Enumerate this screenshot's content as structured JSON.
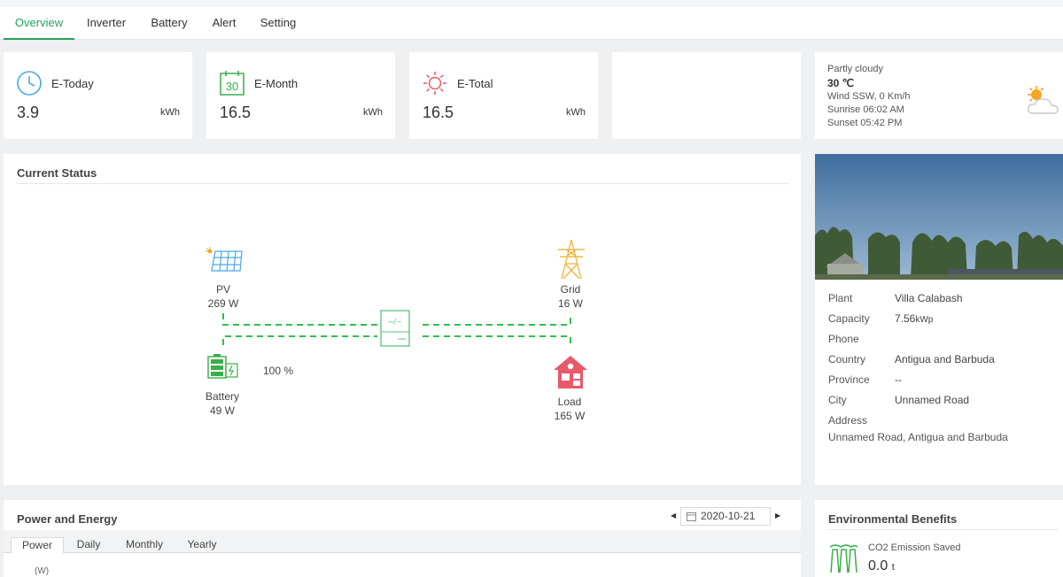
{
  "tabs": [
    {
      "label": "Overview",
      "active": true
    },
    {
      "label": "Inverter",
      "active": false
    },
    {
      "label": "Battery",
      "active": false
    },
    {
      "label": "Alert",
      "active": false
    },
    {
      "label": "Setting",
      "active": false
    }
  ],
  "stats": {
    "today": {
      "label": "E-Today",
      "value": "3.9",
      "unit": "kWh",
      "icon": "clock-icon"
    },
    "month": {
      "label": "E-Month",
      "value": "16.5",
      "unit": "kWh",
      "icon": "calendar-icon",
      "icon_text": "30"
    },
    "total": {
      "label": "E-Total",
      "value": "16.5",
      "unit": "kWh",
      "icon": "sun-icon"
    }
  },
  "weather": {
    "condition": "Partly cloudy",
    "temperature": "30 ℃",
    "wind": "Wind SSW, 0 Km/h",
    "sunrise": "Sunrise 06:02 AM",
    "sunset": "Sunset 05:42 PM",
    "icon": "partly-cloudy-icon"
  },
  "current_status": {
    "title": "Current Status",
    "pv": {
      "label": "PV",
      "value": "269 W"
    },
    "grid": {
      "label": "Grid",
      "value": "16 W"
    },
    "battery": {
      "label": "Battery",
      "value": "49 W",
      "soc": "100 %"
    },
    "load": {
      "label": "Load",
      "value": "165 W"
    },
    "inverter_icon_text": "⎓/~",
    "colors": {
      "flow": "#2fbf4f",
      "pv": "#4aa8e8",
      "grid": "#f0b84a",
      "battery": "#3aae4a",
      "load": "#e8596a",
      "inverter": "#5cc07a"
    }
  },
  "plant": {
    "fields": [
      {
        "key": "Plant",
        "value": "Villa Calabash"
      },
      {
        "key": "Capacity",
        "value": "7.56",
        "unit": "kWp"
      },
      {
        "key": "Phone",
        "value": ""
      },
      {
        "key": "Country",
        "value": "Antigua and Barbuda"
      },
      {
        "key": "Province",
        "value": "--"
      },
      {
        "key": "City",
        "value": "Unnamed Road"
      },
      {
        "key": "Address",
        "value": ""
      }
    ],
    "address_line": "Unnamed Road, Antigua and Barbuda"
  },
  "power_energy": {
    "title": "Power and Energy",
    "date": "2020-10-21",
    "subtabs": [
      {
        "label": "Power",
        "active": true
      },
      {
        "label": "Daily",
        "active": false
      },
      {
        "label": "Monthly",
        "active": false
      },
      {
        "label": "Yearly",
        "active": false
      }
    ],
    "y_unit": "(W)"
  },
  "env": {
    "title": "Environmental Benefits",
    "co2_label": "CO2 Emission Saved",
    "co2_value": "0.0",
    "co2_unit": "t"
  }
}
